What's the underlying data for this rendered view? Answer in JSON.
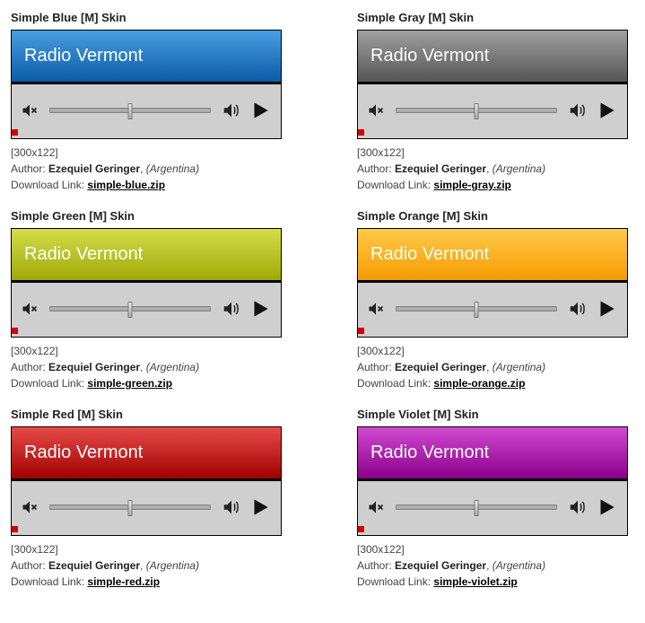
{
  "station_name": "Radio Vermont",
  "dimensions_label": "[300x122]",
  "author_prefix": "Author: ",
  "author_name": "Ezequiel Geringer",
  "author_country_sep": ", ",
  "author_country": "(Argentina)",
  "download_prefix": "Download Link: ",
  "skins": [
    {
      "title": "Simple Blue [M] Skin",
      "grad": "g-blue",
      "zip": "simple-blue.zip"
    },
    {
      "title": "Simple Gray [M] Skin",
      "grad": "g-gray",
      "zip": "simple-gray.zip"
    },
    {
      "title": "Simple Green [M] Skin",
      "grad": "g-green",
      "zip": "simple-green.zip"
    },
    {
      "title": "Simple Orange [M] Skin",
      "grad": "g-orange",
      "zip": "simple-orange.zip"
    },
    {
      "title": "Simple Red [M] Skin",
      "grad": "g-red",
      "zip": "simple-red.zip"
    },
    {
      "title": "Simple Violet [M] Skin",
      "grad": "g-violet",
      "zip": "simple-violet.zip"
    }
  ]
}
